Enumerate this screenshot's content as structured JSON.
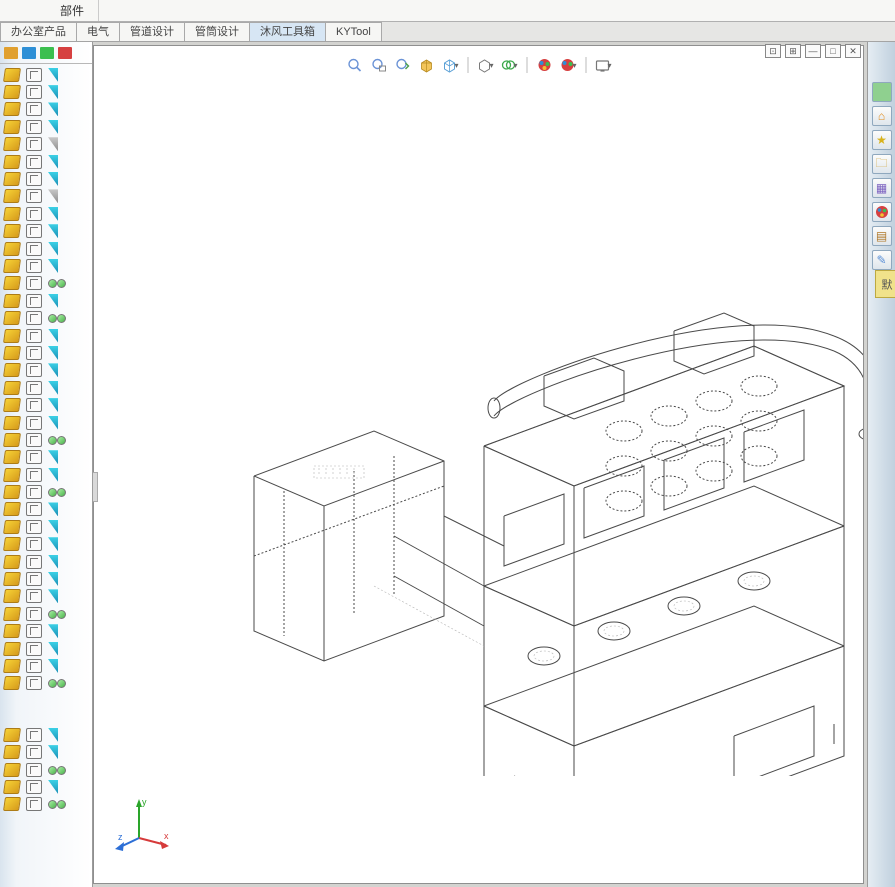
{
  "menu": {
    "items": [
      "部件"
    ]
  },
  "tabs": [
    "办公室产品",
    "电气",
    "管道设计",
    "管筒设计",
    "沐风工具箱",
    "KYTool"
  ],
  "window_controls": [
    "⊡",
    "⊞",
    "—",
    "□",
    "✕"
  ],
  "right_tab": "默",
  "view_toolbar": {
    "zoom_fit": "🔍",
    "zoom_area": "🔍",
    "prev_view": "↩",
    "section": "📦",
    "display_style": "▧",
    "orientation": "⬚",
    "hide_show": "👁",
    "appearance": "●",
    "scene": "●",
    "render": "▦"
  },
  "triad": {
    "x": "x",
    "y": "y",
    "z": "z"
  }
}
